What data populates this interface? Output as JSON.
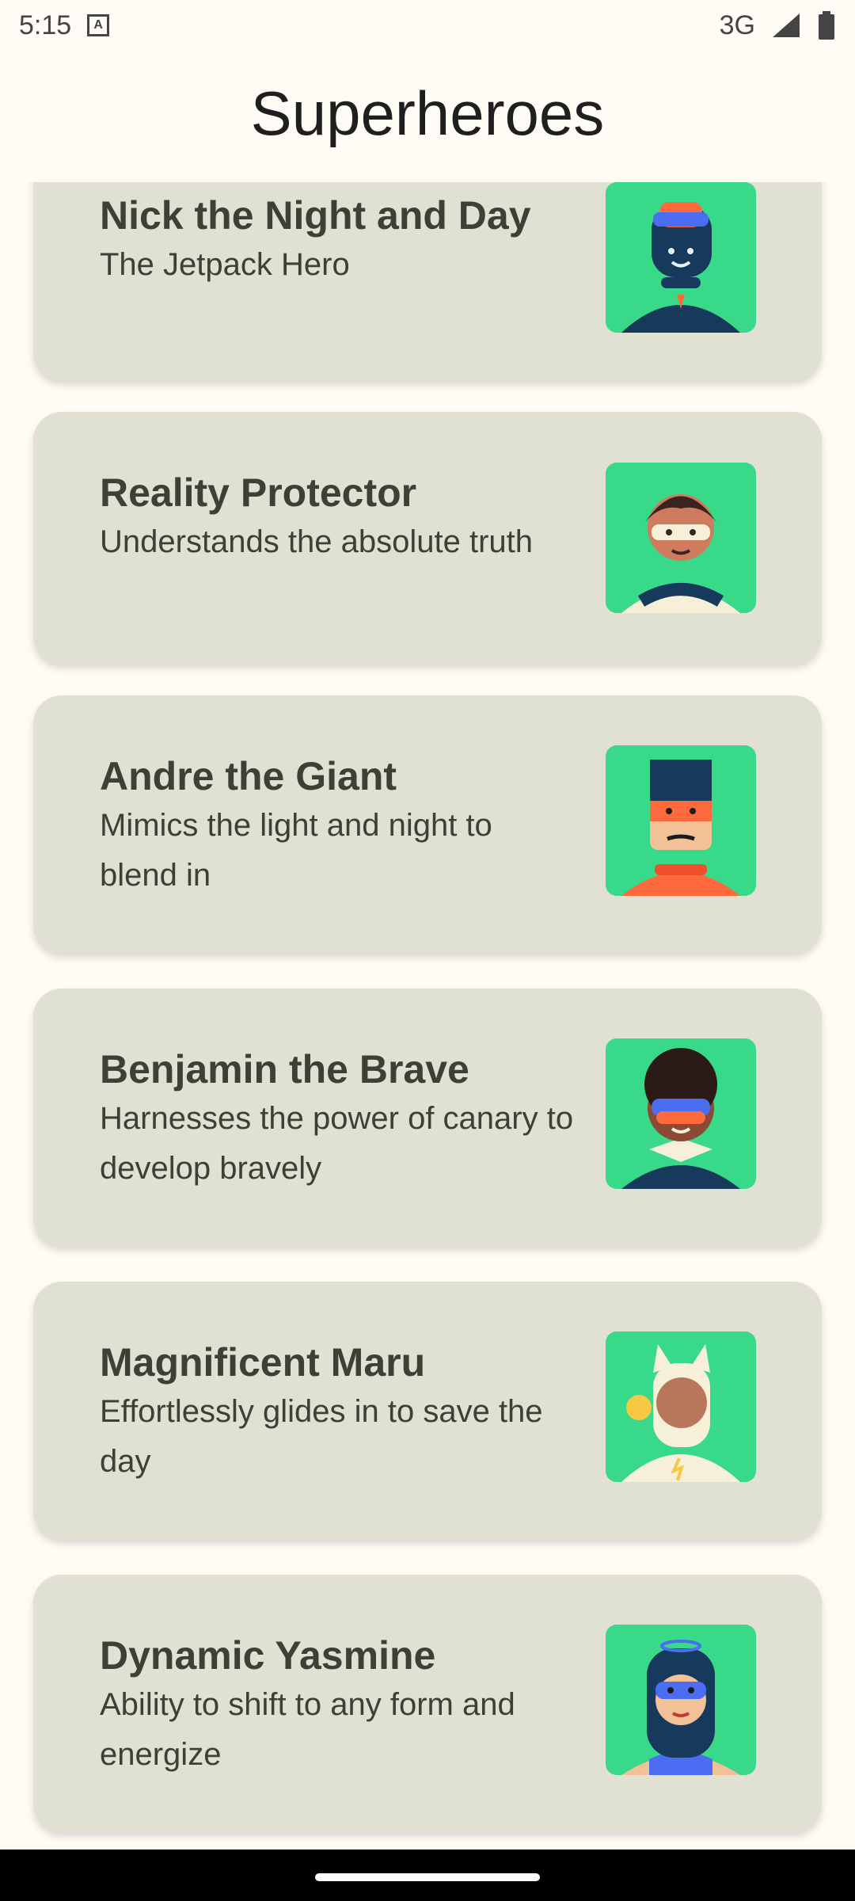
{
  "status_bar": {
    "time": "5:15",
    "network": "3G",
    "keyboard_icon": "A"
  },
  "app": {
    "title": "Superheroes"
  },
  "heroes": [
    {
      "name": "Nick the Night and Day",
      "description": "The Jetpack Hero"
    },
    {
      "name": "Reality Protector",
      "description": "Understands the absolute truth"
    },
    {
      "name": "Andre the Giant",
      "description": "Mimics the light and night to blend in"
    },
    {
      "name": "Benjamin the Brave",
      "description": "Harnesses the power of canary to develop bravely"
    },
    {
      "name": "Magnificent Maru",
      "description": "Effortlessly glides in to save the day"
    },
    {
      "name": "Dynamic Yasmine",
      "description": "Ability to shift to any form and energize"
    }
  ]
}
